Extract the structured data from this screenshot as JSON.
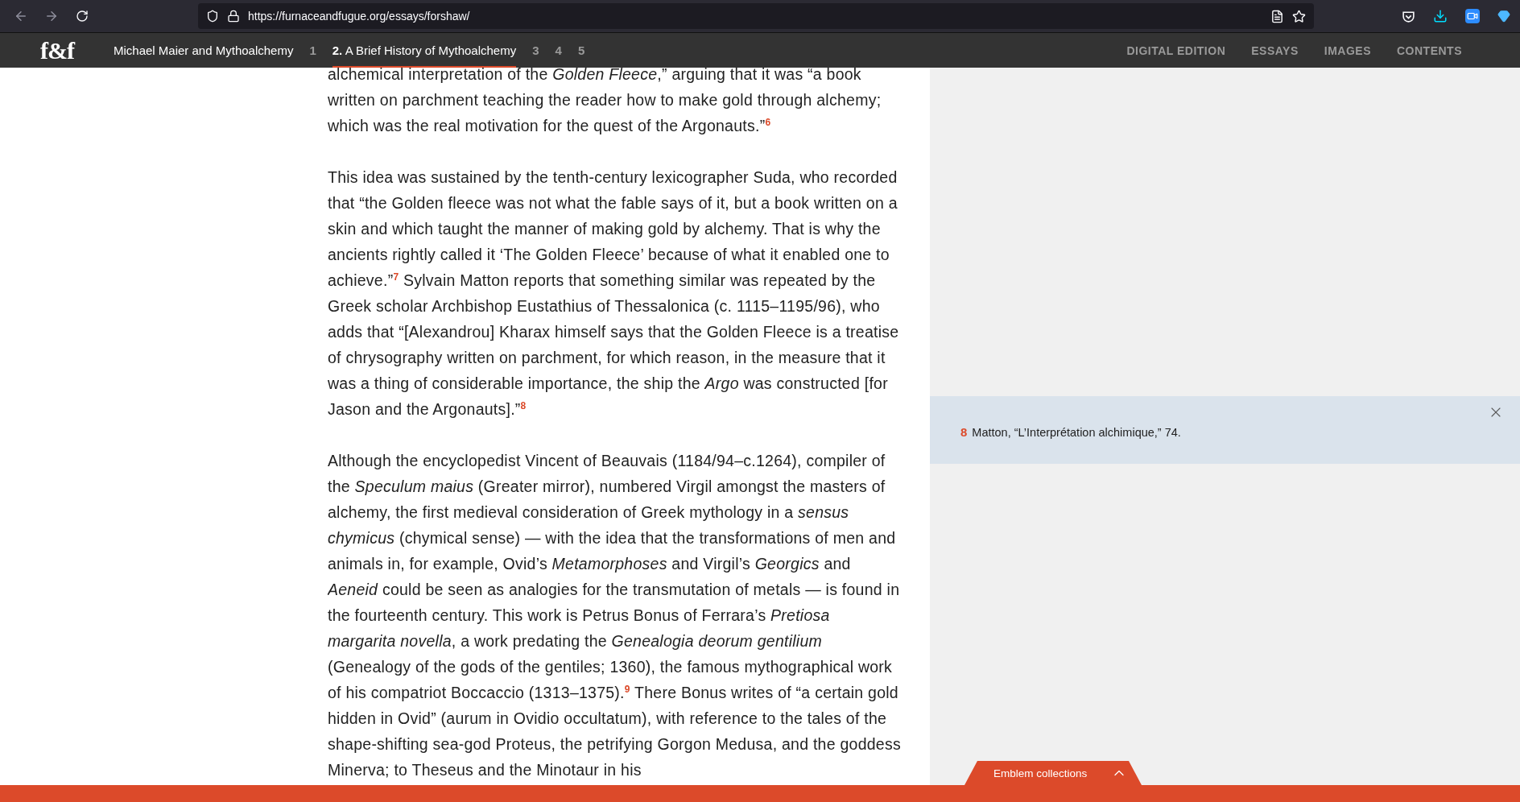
{
  "browser": {
    "url": "https://furnaceandfugue.org/essays/forshaw/"
  },
  "site_nav": {
    "logo": "f&f",
    "essay_title": "Michael Maier and Mythoalchemy",
    "chapters": [
      {
        "label": "1",
        "selected": false
      },
      {
        "label": "**2.** A Brief History of Mythoalchemy",
        "selected": true
      },
      {
        "label": "3",
        "selected": false
      },
      {
        "label": "4",
        "selected": false
      },
      {
        "label": "5",
        "selected": false
      }
    ],
    "menu": [
      "DIGITAL EDITION",
      "ESSAYS",
      "IMAGES",
      "CONTENTS"
    ]
  },
  "article": {
    "paragraphs": [
      "alchemical interpretation of the *Golden Fleece*,” arguing that it was “a book written on parchment teaching the reader how to make gold through alchemy; which was the real motivation for the quest of the Argonauts.”$^{6}$",
      "This idea was sustained by the tenth-century lexicographer Suda, who recorded that “the Golden fleece was not what the fable says of it, but a book written on a skin and which taught the manner of making gold by alchemy. That is why the ancients rightly called it ‘The Golden Fleece’ because of what it enabled one to achieve.”$^{7}$ Sylvain Matton reports that something similar was repeated by the Greek scholar Archbishop Eustathius of Thessalonica (c. 1115–1195/96), who adds that “[Alexandrou] Kharax himself says that the Golden Fleece is a treatise of chrysography written on parchment, for which reason, in the measure that it was a thing of considerable importance, the ship the *Argo* was constructed [for Jason and the Argonauts].”$^{8}$",
      "Although the encyclopedist Vincent of Beauvais (1184/94–c.1264), compiler of the *Speculum maius* (Greater mirror), numbered Virgil amongst the masters of alchemy, the first medieval consideration of Greek mythology in a *sensus chymicus* (chymical sense) — with the idea that the transformations of men and animals in, for example, Ovid’s *Metamorphoses* and Virgil’s *Georgics* and *Aeneid* could be seen as analogies for the transmutation of metals — is found in the fourteenth century. This work is Petrus Bonus of Ferrara’s *Pretiosa margarita novella*, a work predating the *Genealogia deorum gentilium* (Genealogy of the gods of the gentiles; 1360), the famous mythographical work of his compatriot Boccaccio (1313–1375).$^{9}$ There Bonus writes of “a certain gold hidden in Ovid” (aurum in Ovidio occultatum), with reference to the tales of the shape-shifting sea-god Proteus, the petrifying Gorgon Medusa, and the goddess Minerva; to Theseus and the Minotaur in his"
    ]
  },
  "footnote": {
    "number": "8",
    "text": "Matton, “L’Interprétation alchimique,” 74."
  },
  "bottom_tab": {
    "label": "Emblem collections",
    "expanded": false
  }
}
